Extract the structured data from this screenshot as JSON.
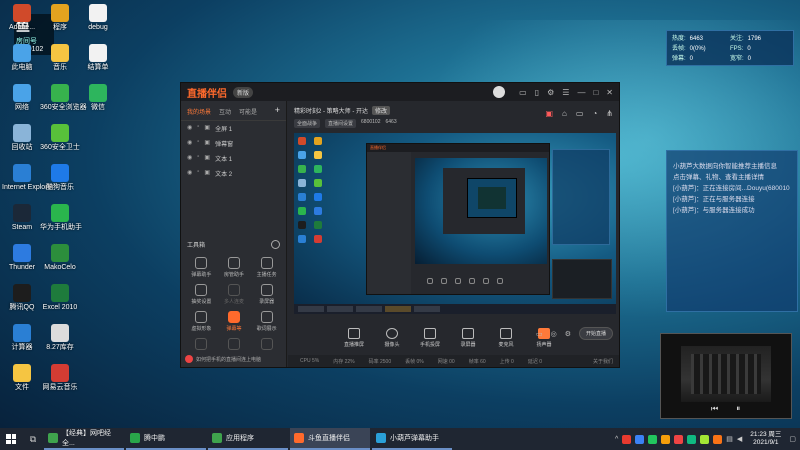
{
  "desktop": {
    "streamer_badge": {
      "logo": "鱼",
      "room_label": "房间号",
      "room_number": "6800102"
    },
    "icons": [
      {
        "label": "Adobe...",
        "color": "#d04a2a",
        "col": 0,
        "row": 0
      },
      {
        "label": "程序",
        "color": "#e3a31f",
        "col": 1,
        "row": 0
      },
      {
        "label": "debug",
        "color": "#f2f2f2",
        "col": 2,
        "row": 0
      },
      {
        "label": "此电脑",
        "color": "#4aa3e8",
        "col": 0,
        "row": 1
      },
      {
        "label": "音乐",
        "color": "#f5c542",
        "col": 1,
        "row": 1
      },
      {
        "label": "结算单",
        "color": "#f2f2f2",
        "col": 2,
        "row": 1
      },
      {
        "label": "网络",
        "color": "#4aa3e8",
        "col": 0,
        "row": 2
      },
      {
        "label": "360安全浏览器",
        "color": "#37b24d",
        "col": 1,
        "row": 2
      },
      {
        "label": "微信",
        "color": "#2db55d",
        "col": 2,
        "row": 2
      },
      {
        "label": "回收站",
        "color": "#8ab4d8",
        "col": 0,
        "row": 3
      },
      {
        "label": "360安全卫士",
        "color": "#58c13a",
        "col": 1,
        "row": 3
      },
      {
        "label": "Internet Explorer",
        "color": "#2a7fd4",
        "col": 0,
        "row": 4
      },
      {
        "label": "酷狗音乐",
        "color": "#1e7ae8",
        "col": 1,
        "row": 4
      },
      {
        "label": "Steam",
        "color": "#1b2838",
        "col": 0,
        "row": 5
      },
      {
        "label": "华为手机助手",
        "color": "#2ab54d",
        "col": 1,
        "row": 5
      },
      {
        "label": "Thunder",
        "color": "#2d7be0",
        "col": 0,
        "row": 6
      },
      {
        "label": "MakoCelo",
        "color": "#2c8e3c",
        "col": 1,
        "row": 6
      },
      {
        "label": "腾讯QQ",
        "color": "#1d1d1d",
        "col": 0,
        "row": 7
      },
      {
        "label": "Excel 2010",
        "color": "#1e7b3c",
        "col": 1,
        "row": 7
      },
      {
        "label": "计算器",
        "color": "#2a7fd4",
        "col": 0,
        "row": 8
      },
      {
        "label": "8.27库存",
        "color": "#dcdcdc",
        "col": 1,
        "row": 8
      },
      {
        "label": "文件",
        "color": "#f5c542",
        "col": 0,
        "row": 9
      },
      {
        "label": "网易云音乐",
        "color": "#d43c33",
        "col": 1,
        "row": 9
      }
    ]
  },
  "app": {
    "logo": "直播伴侣",
    "version": "新版",
    "left_tabs": [
      "我的场景",
      "互动",
      "可能是"
    ],
    "scenes": [
      "全屏 1",
      "弹幕窗",
      "文本 1",
      "文本 2"
    ],
    "toolbox_title": "工具箱",
    "tools": [
      {
        "label": "弹幕助手",
        "state": "normal"
      },
      {
        "label": "房管助手",
        "state": "normal"
      },
      {
        "label": "主播任务",
        "state": "normal"
      },
      {
        "label": "抽奖设置",
        "state": "normal"
      },
      {
        "label": "多人连麦",
        "state": "dim"
      },
      {
        "label": "录屏器",
        "state": "normal"
      },
      {
        "label": "虚拟形象",
        "state": "normal"
      },
      {
        "label": "弹幕等",
        "state": "hot"
      },
      {
        "label": "歌词展示",
        "state": "normal"
      },
      {
        "label": "",
        "state": "dim"
      },
      {
        "label": "",
        "state": "dim"
      },
      {
        "label": "",
        "state": "dim"
      }
    ],
    "left_footer": "如何把手机的直播间连上电脑",
    "room": {
      "title": "精彩时刻2 - 策略大师 - 开达",
      "edit_label": "修改",
      "category_chip": "全面战争",
      "settings_chip": "直播间设置",
      "id_text": "6800102",
      "heat_text": "6463"
    },
    "controls": [
      {
        "label": "直播推屏",
        "round": false
      },
      {
        "label": "摄像头",
        "round": true
      },
      {
        "label": "手机投屏",
        "round": false
      },
      {
        "label": "录屏器",
        "round": false
      },
      {
        "label": "麦克风",
        "round": false
      },
      {
        "label": "扬声器",
        "round": false,
        "volume": true
      }
    ],
    "start_button": "开始直播",
    "status_items": [
      "CPU 5%",
      "内存 22%",
      "码率 2500",
      "丢帧 0%",
      "网速 00",
      "帧率 60",
      "上传 0",
      "延迟 0"
    ],
    "status_tail": "关于我们"
  },
  "stats": {
    "rows": [
      [
        {
          "k": "热度:",
          "v": "6463"
        },
        {
          "k": "关注:",
          "v": "1796"
        }
      ],
      [
        {
          "k": "丢帧:",
          "v": "0(0%)"
        },
        {
          "k": "FPS:",
          "v": "0"
        }
      ],
      [
        {
          "k": "弹幕:",
          "v": "0"
        },
        {
          "k": "宽窄:",
          "v": "0"
        }
      ]
    ]
  },
  "chat": {
    "lines": [
      "小葫芦大数据向你智能推荐主播信息",
      "点击弹幕、礼物、查看主播详情",
      "[小葫芦]：正在连接房间...Douyu(680010",
      "[小葫芦]：正在与服务器连接",
      "[小葫芦]：与服务器连接成功"
    ]
  },
  "video_controls": {
    "prev": "⏮",
    "pause": "⏸"
  },
  "taskbar": {
    "tasks": [
      {
        "label": "【经典】网吧经全...",
        "color": "#3fa34d",
        "active": false
      },
      {
        "label": "腾中鹏",
        "color": "#29a64a",
        "active": false
      },
      {
        "label": "应用程序",
        "color": "#3fa34d",
        "active": false
      },
      {
        "label": "斗鱼直播伴侣",
        "color": "#ff6a2c",
        "active": true
      },
      {
        "label": "小葫芦弹幕助手",
        "color": "#2aa0d8",
        "active": false
      }
    ],
    "clock_time": "21:23 周三",
    "clock_date": "2021/9/1",
    "tray_colors": [
      "#e83a2f",
      "#3b82f6",
      "#22c55e",
      "#f59e0b",
      "#ef4444",
      "#10b981",
      "#a3e635",
      "#f97316"
    ]
  }
}
